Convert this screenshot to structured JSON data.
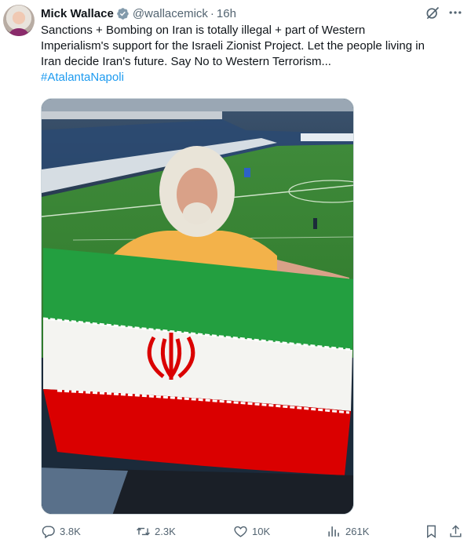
{
  "author": {
    "name": "Mick Wallace",
    "handle": "@wallacemick",
    "separator": "·",
    "time": "16h"
  },
  "tweet": {
    "lines": [
      "Sanctions + Bombing on Iran is totally illegal + part of Western",
      "Imperialism's support for the Israeli Zionist Project. Let the people living in",
      "Iran decide Iran's future. Say No to Western Terrorism..."
    ],
    "hashtag": "#AtalantaNapoli"
  },
  "actions": {
    "replies": "3.8K",
    "reposts": "2.3K",
    "likes": "10K",
    "views": "261K"
  },
  "colors": {
    "accent": "#1d9bf0",
    "muted": "#536471",
    "text": "#0f1419",
    "flag_green": "#239f40",
    "flag_red": "#da0000"
  },
  "icons": [
    "verified-badge-icon",
    "grok-icon",
    "more-icon",
    "reply-icon",
    "retweet-icon",
    "like-icon",
    "views-icon",
    "bookmark-icon",
    "share-icon"
  ]
}
